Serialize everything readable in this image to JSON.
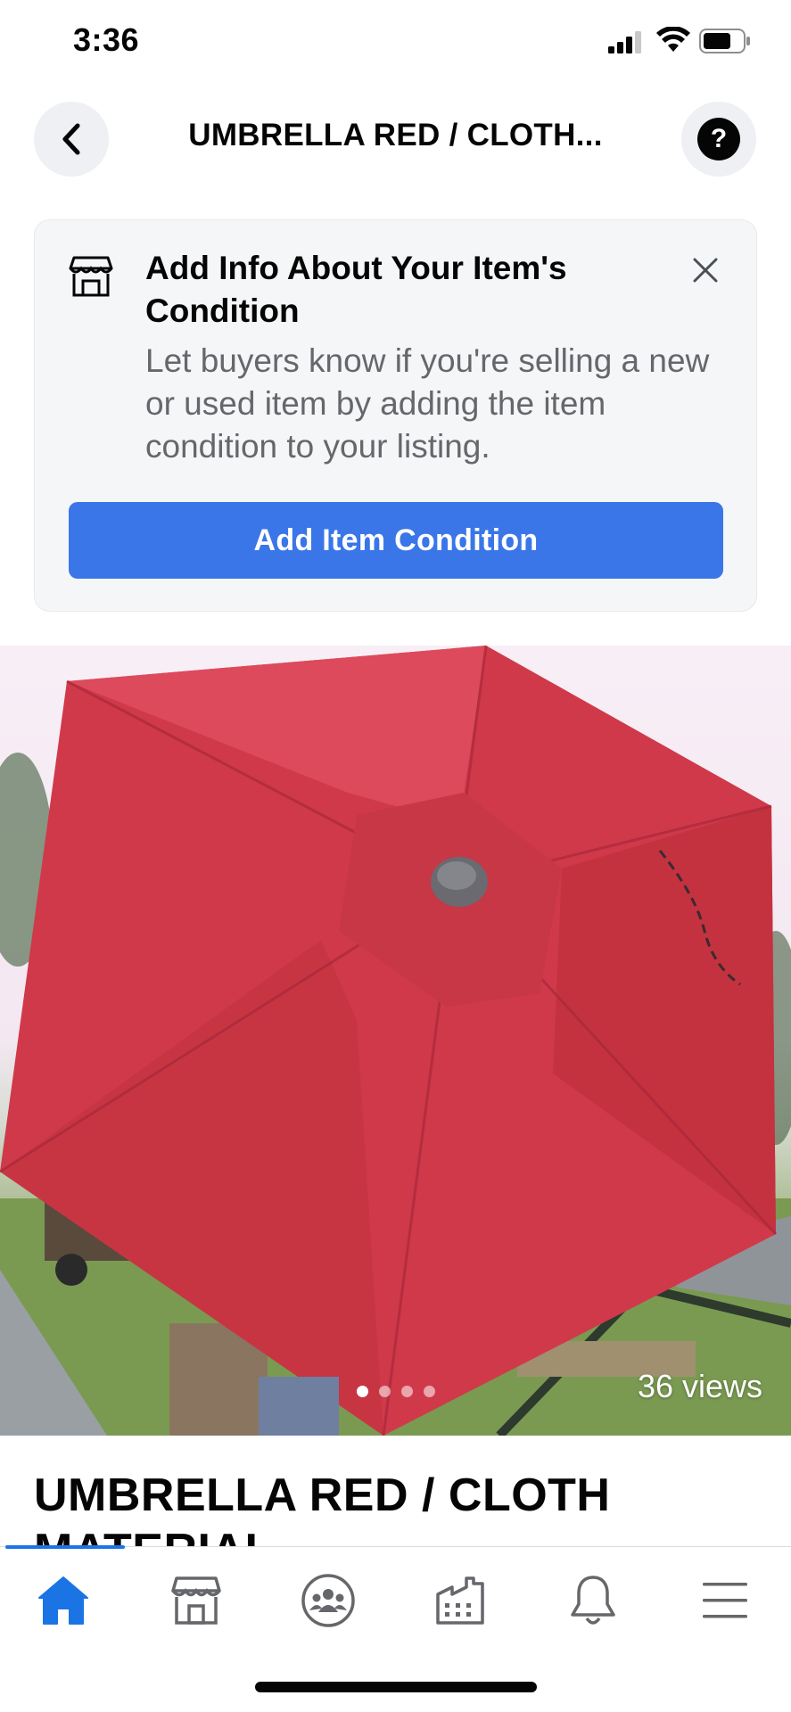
{
  "status_bar": {
    "time": "3:36",
    "icons": [
      "signal-icon",
      "wifi-icon",
      "battery-icon"
    ]
  },
  "header": {
    "title": "UMBRELLA RED / CLOTH...",
    "back_icon": "chevron-left-icon",
    "help_icon": "question-mark-icon",
    "help_glyph": "?"
  },
  "condition_card": {
    "icon": "store-icon",
    "title": "Add Info About Your Item's Condition",
    "description": "Let buyers know if you're selling a new or used item by adding the item condition to your listing.",
    "button_label": "Add Item Condition",
    "close_icon": "close-icon"
  },
  "photo": {
    "views": "36 views",
    "image_count": 4,
    "active_index": 0
  },
  "listing": {
    "title": "UMBRELLA RED / CLOTH MATERIAL"
  },
  "bottom_nav": {
    "items": [
      {
        "icon": "home-icon",
        "active": true
      },
      {
        "icon": "marketplace-icon",
        "active": false
      },
      {
        "icon": "groups-icon",
        "active": false
      },
      {
        "icon": "pages-icon",
        "active": false
      },
      {
        "icon": "notifications-icon",
        "active": false
      },
      {
        "icon": "menu-icon",
        "active": false
      }
    ],
    "active_color": "#1b74e4",
    "inactive_color": "#65676b"
  },
  "colors": {
    "accent": "#3a76e8",
    "umbrella_red": "#d0394a"
  }
}
